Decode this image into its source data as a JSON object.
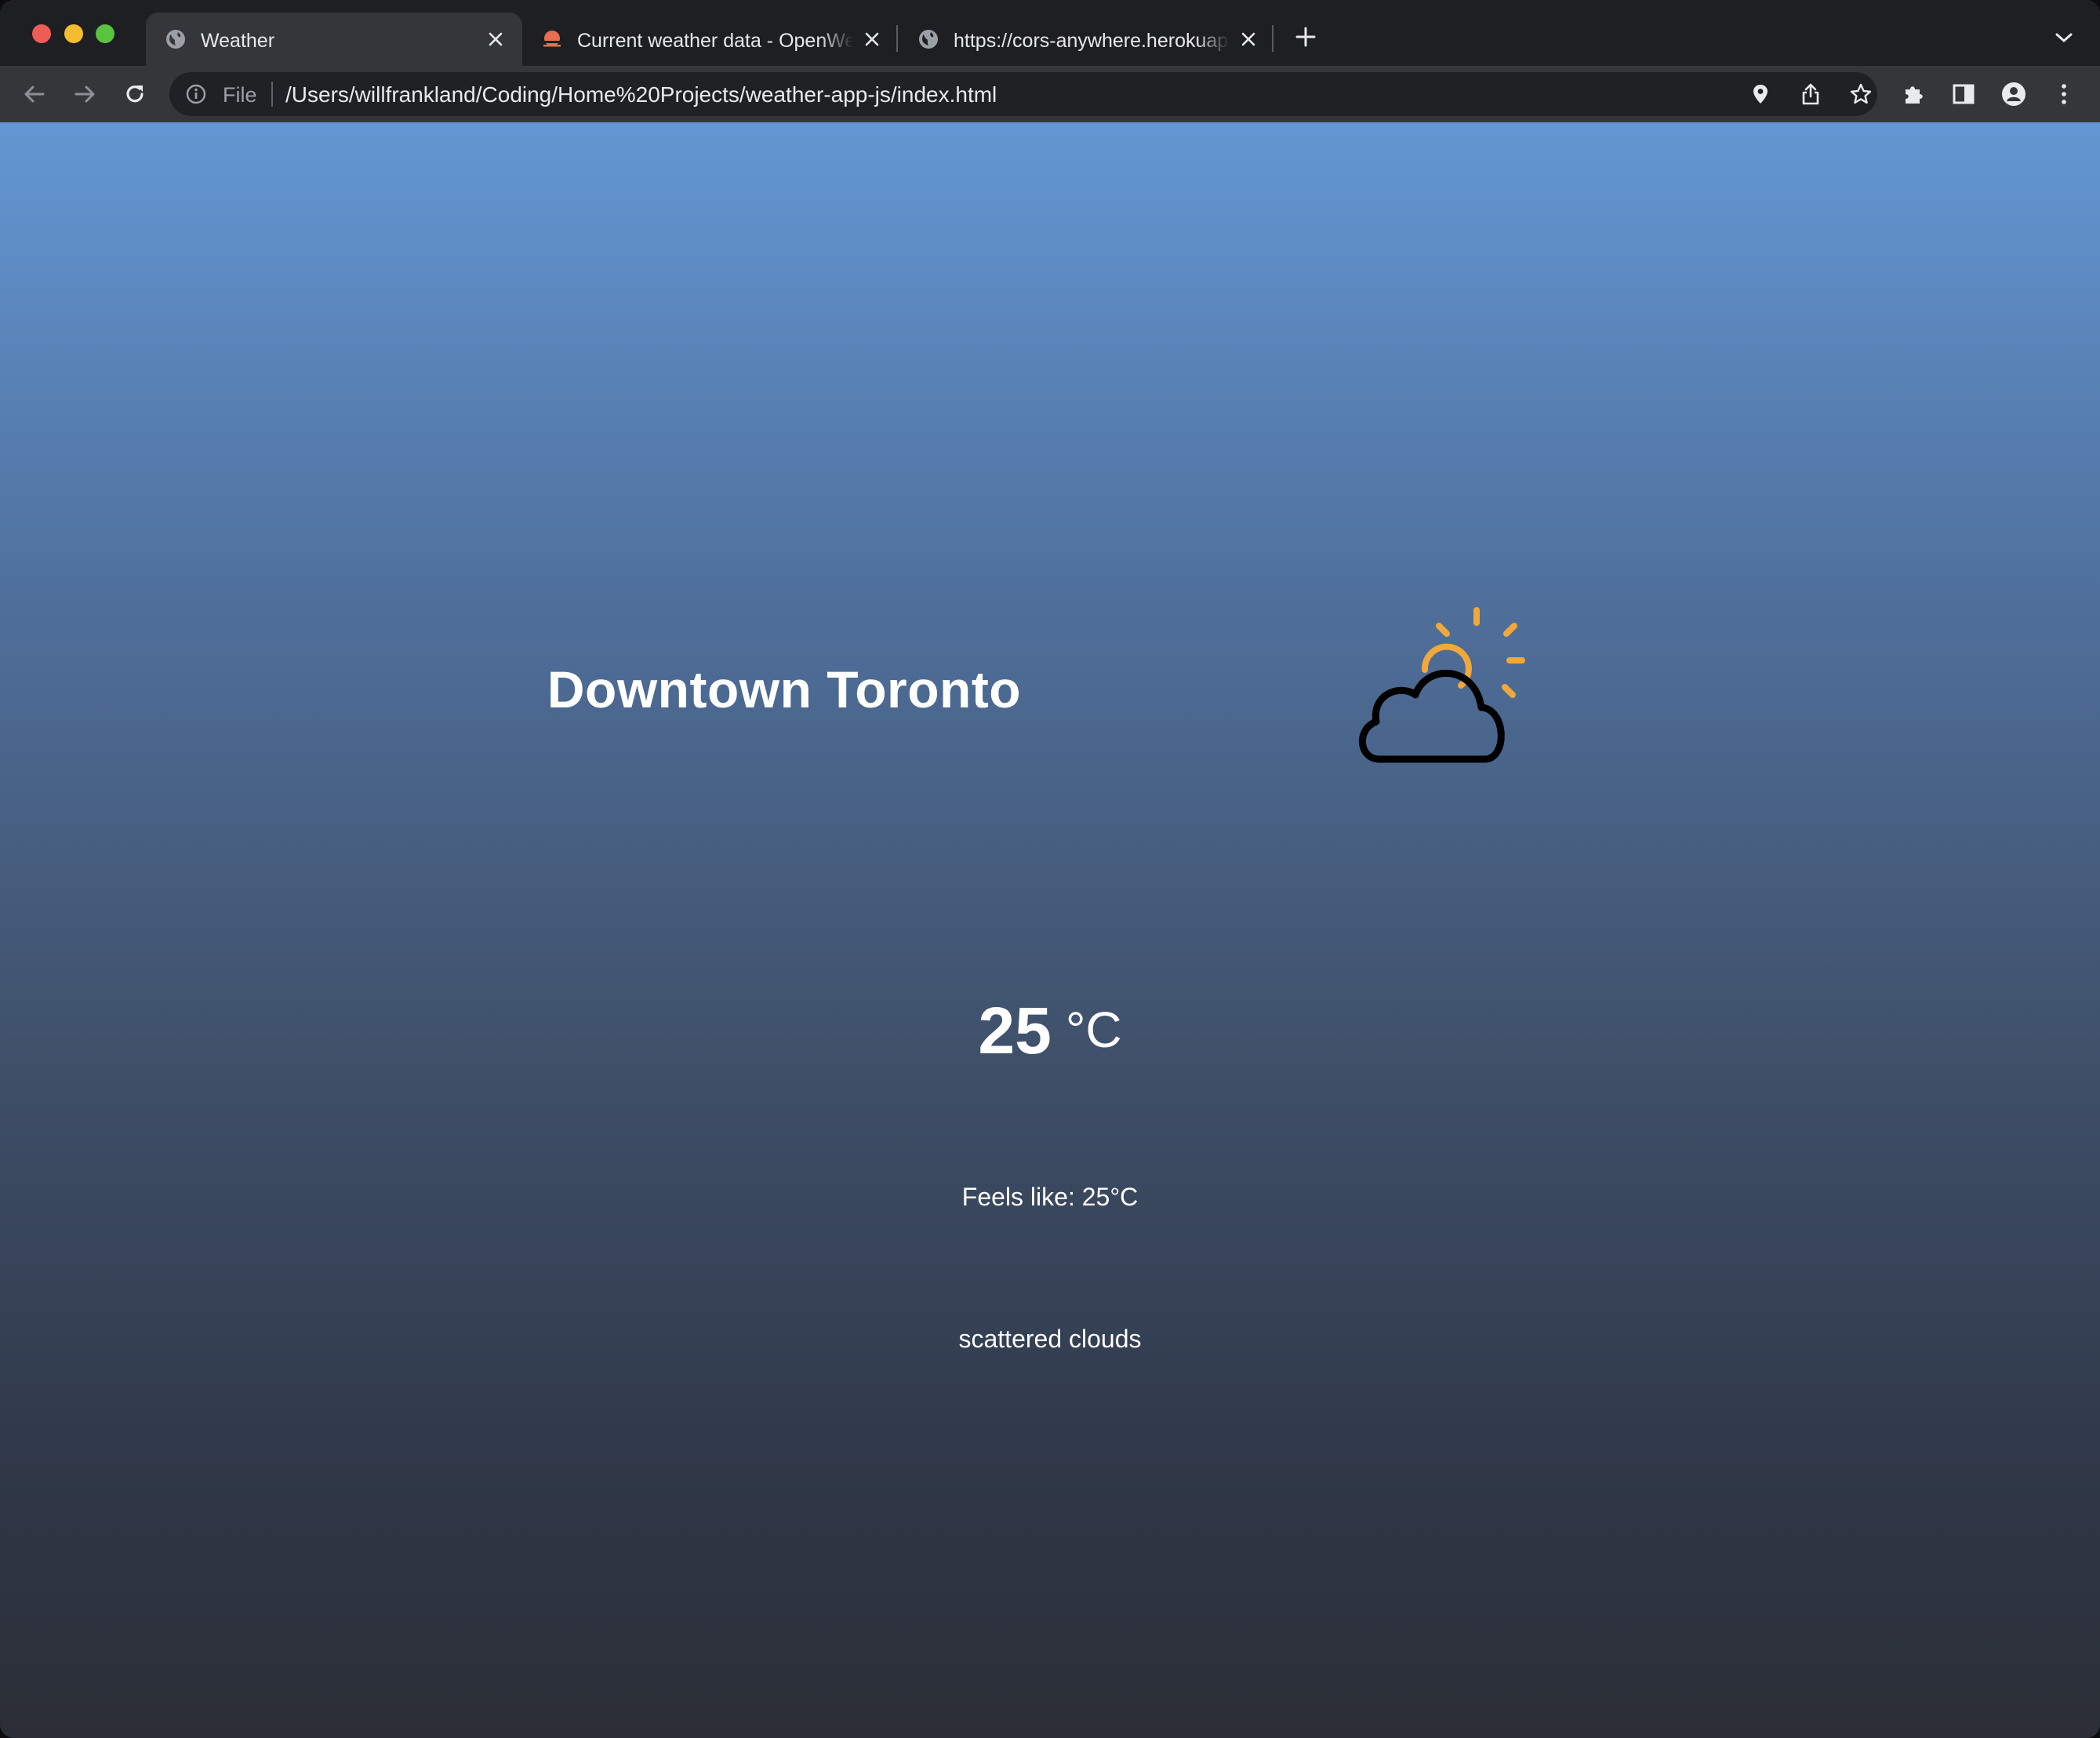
{
  "browser": {
    "tabs": [
      {
        "title": "Weather",
        "favicon": "globe-icon",
        "active": true
      },
      {
        "title": "Current weather data - OpenWeatherMap",
        "favicon": "openweather-logo-icon",
        "active": false
      },
      {
        "title": "https://cors-anywhere.herokuapp.com",
        "favicon": "globe-icon",
        "active": false
      }
    ],
    "omnibox": {
      "scheme_label": "File",
      "url": "/Users/willfrankland/Coding/Home%20Projects/weather-app-js/index.html"
    },
    "colors": {
      "close": "#ee5c55",
      "minimize": "#f3bd2f",
      "maximize": "#59c33e"
    }
  },
  "weather": {
    "location": "Downtown Toronto",
    "temperature": "25",
    "unit": "°C",
    "feels_like": "Feels like: 25°C",
    "description": "scattered clouds",
    "icon": "partly-cloudy-icon",
    "colors": {
      "sun": "#f0a83a",
      "cloud_outline": "#000000",
      "text": "#ffffff"
    }
  }
}
